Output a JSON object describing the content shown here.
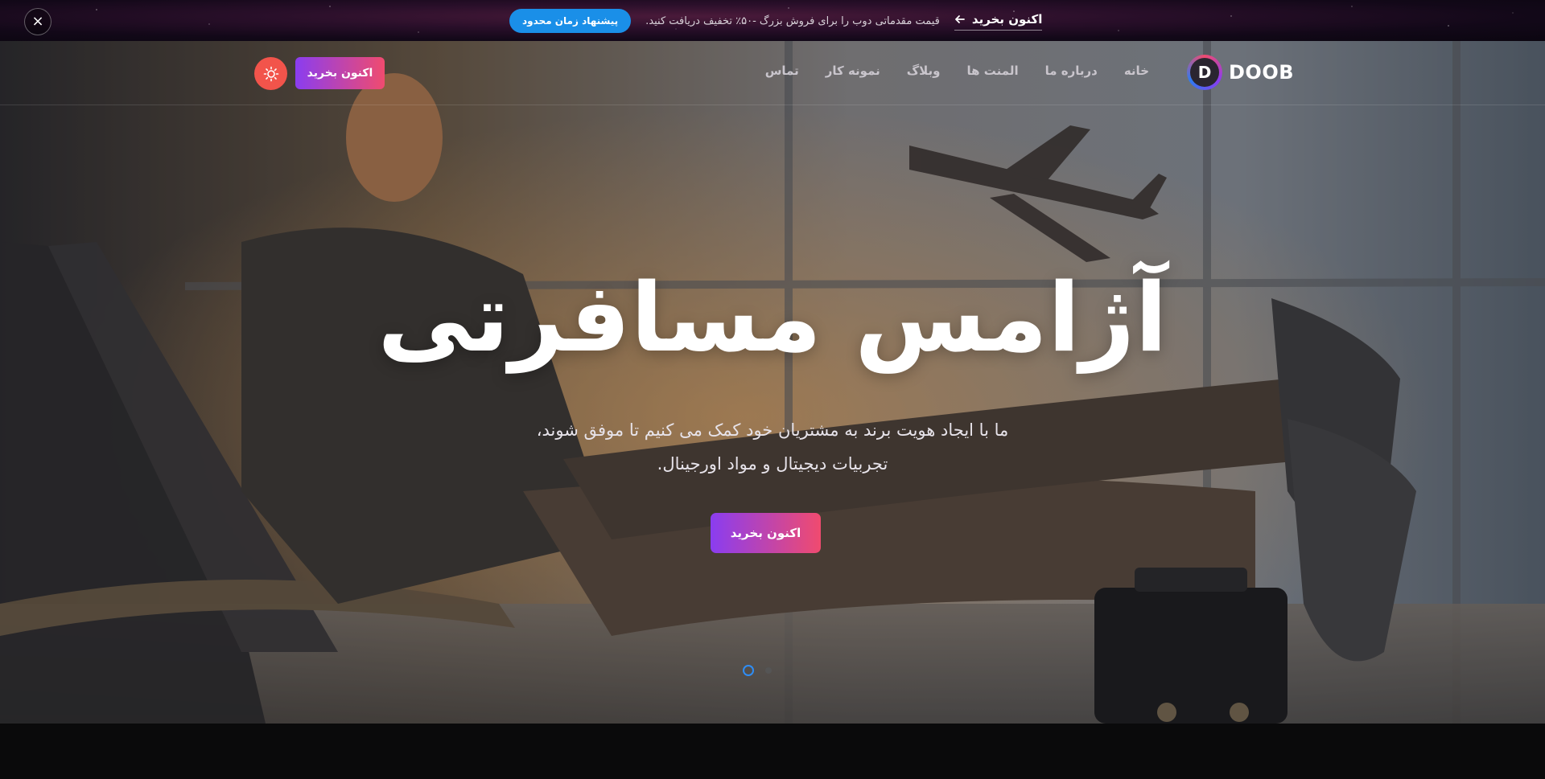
{
  "promo": {
    "close_icon": "×",
    "badge": "پیشنهاد زمان محدود",
    "text": "قیمت مقدماتی دوب را برای فروش بزرگ -۵۰٪ تخفیف دریافت کنید.",
    "link_label": "اکنون بخرید",
    "link_icon": "arrow-left"
  },
  "header": {
    "logo_letter": "D",
    "logo_text": "DOOB",
    "nav": [
      "خانه",
      "درباره ما",
      "المنت ها",
      "وبلاگ",
      "نمونه کار",
      "تماس"
    ],
    "buy_button": "اکنون بخرید",
    "theme_icon": "sun-icon"
  },
  "hero": {
    "title": "آژامس مسافرتی",
    "subtitle_line1": "ما با ایجاد هویت برند به مشتریان خود کمک می کنیم تا موفق شوند،",
    "subtitle_line2": "تجربیات دیجیتال و مواد اورجینال.",
    "cta": "اکنون بخرید",
    "slides_count": 2,
    "active_slide": 1
  },
  "colors": {
    "accent_start": "#8a3df0",
    "accent_end": "#f04b6f",
    "badge_blue": "#1a8fe8",
    "theme_btn": "#f2544b"
  }
}
